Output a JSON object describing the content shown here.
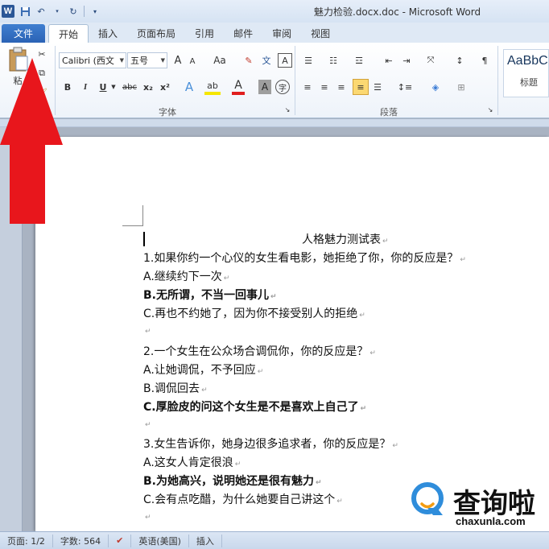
{
  "window": {
    "title": "魅力检验.docx.doc - Microsoft Word",
    "app_logo": "W"
  },
  "tabs": {
    "file": "文件",
    "items": [
      "开始",
      "插入",
      "页面布局",
      "引用",
      "邮件",
      "审阅",
      "视图"
    ],
    "active": "开始"
  },
  "ribbon": {
    "clipboard": {
      "paste_label": "粘"
    },
    "font": {
      "group_label": "字体",
      "font_name": "Calibri (西文",
      "font_size": "五号",
      "grow": "A",
      "shrink": "A",
      "change_case": "Aa",
      "bold": "B",
      "italic": "I",
      "underline": "U",
      "strike": "abc",
      "subscript": "x₂",
      "superscript": "x²",
      "text_effect": "A",
      "highlight": "ab",
      "font_color": "A",
      "char_shading": "A",
      "enclose": "字"
    },
    "paragraph": {
      "group_label": "段落"
    },
    "styles": {
      "sample": "AaBbC",
      "name": "标题"
    }
  },
  "document": {
    "title": "人格魅力测试表",
    "lines": [
      {
        "text": "1.如果你约一个心仪的女生看电影，她拒绝了你，你的反应是？",
        "bold": false
      },
      {
        "text": "A.继续约下一次",
        "bold": false
      },
      {
        "text": "B.无所谓，不当一回事儿",
        "bold": true
      },
      {
        "text": "C.再也不约她了，因为你不接受别人的拒绝",
        "bold": false
      },
      {
        "text": "",
        "bold": false
      },
      {
        "text": "2.一个女生在公众场合调侃你，你的反应是？",
        "bold": false
      },
      {
        "text": "A.让她调侃，不予回应",
        "bold": false
      },
      {
        "text": "B.调侃回去",
        "bold": false
      },
      {
        "text": "C.厚脸皮的问这个女生是不是喜欢上自己了",
        "bold": true
      },
      {
        "text": "",
        "bold": false
      },
      {
        "text": "3.女生告诉你，她身边很多追求者，你的反应是？",
        "bold": false
      },
      {
        "text": "A.这女人肯定很浪",
        "bold": false
      },
      {
        "text": "B.为她高兴，说明她还是很有魅力",
        "bold": true
      },
      {
        "text": "C.会有点吃醋，为什么她要自己讲这个",
        "bold": false
      },
      {
        "text": "",
        "bold": false
      }
    ]
  },
  "status": {
    "page": "页面: 1/2",
    "words": "字数: 564",
    "language": "英语(美国)",
    "mode": "插入"
  },
  "watermark": {
    "name": "查询啦",
    "url": "chaxunla.com"
  },
  "colors": {
    "accent": "#2b5797",
    "arrow": "#e8161c",
    "watermark_blue": "#2f8ddb"
  }
}
